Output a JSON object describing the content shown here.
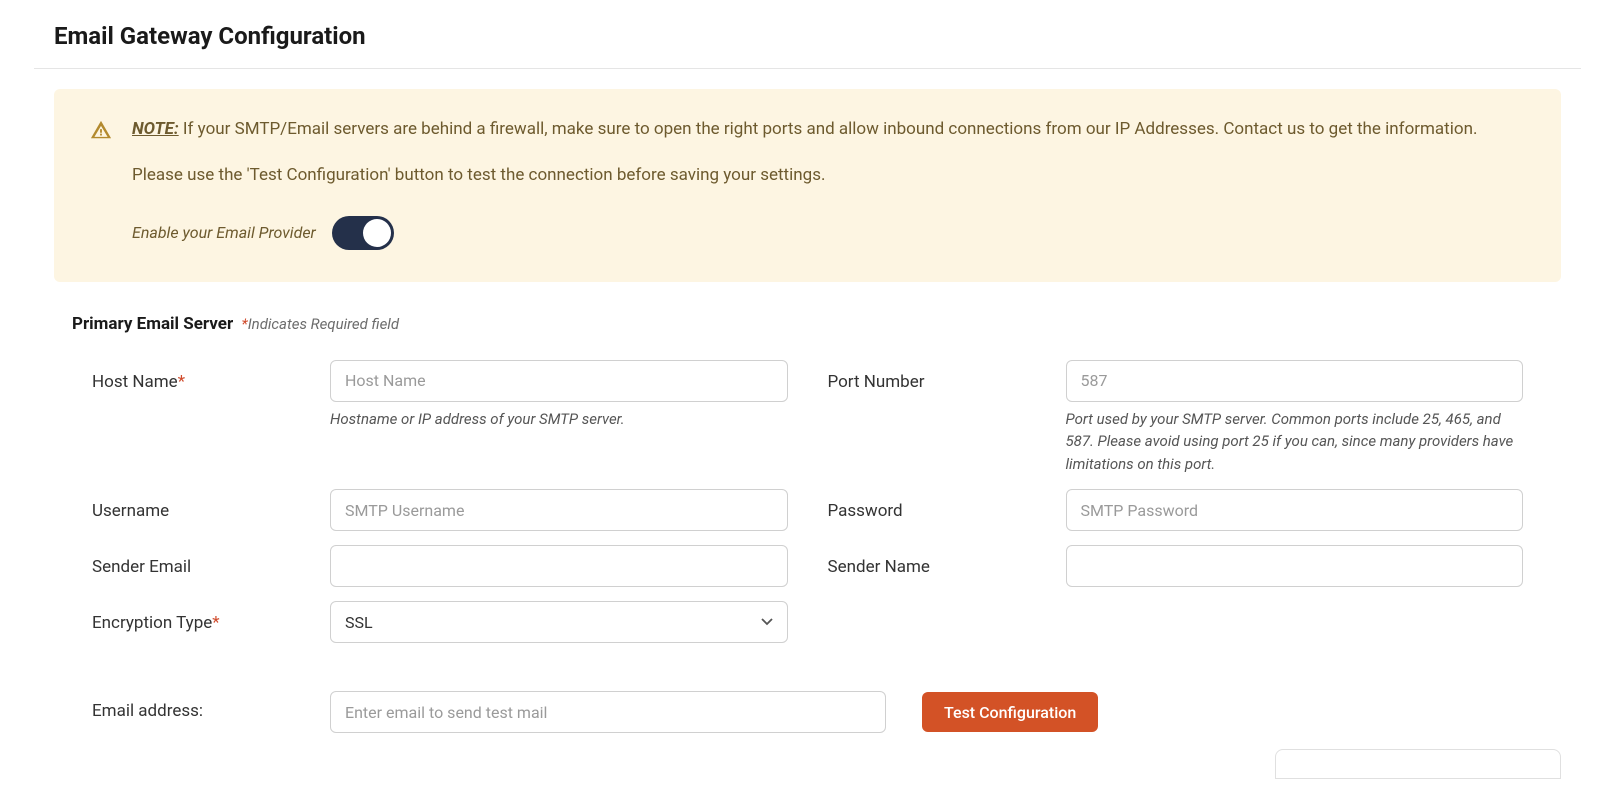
{
  "page": {
    "title": "Email Gateway Configuration"
  },
  "note": {
    "label": "NOTE:",
    "text1": " If your SMTP/Email servers are behind a firewall, make sure to open the right ports and allow inbound connections from our IP Addresses. Contact us to get the information.",
    "text2": "Please use the 'Test Configuration' button to test the connection before saving your settings.",
    "toggle_label": "Enable your Email Provider",
    "toggle_on": true
  },
  "section": {
    "title": "Primary Email Server",
    "required_note": "Indicates Required field"
  },
  "fields": {
    "hostname": {
      "label": "Host Name",
      "placeholder": "Host Name",
      "helper": "Hostname or IP address of your SMTP server.",
      "value": ""
    },
    "port": {
      "label": "Port Number",
      "placeholder": "587",
      "helper": "Port used by your SMTP server. Common ports include 25, 465, and 587. Please avoid using port 25 if you can, since many providers have limitations on this port.",
      "value": ""
    },
    "username": {
      "label": "Username",
      "placeholder": "SMTP Username",
      "value": ""
    },
    "password": {
      "label": "Password",
      "placeholder": "SMTP Password",
      "value": ""
    },
    "sender_email": {
      "label": "Sender Email",
      "value": ""
    },
    "sender_name": {
      "label": "Sender Name",
      "value": ""
    },
    "encryption": {
      "label": "Encryption Type",
      "value": "SSL"
    }
  },
  "test": {
    "label": "Email address:",
    "placeholder": "Enter email to send test mail",
    "button": "Test Configuration"
  }
}
